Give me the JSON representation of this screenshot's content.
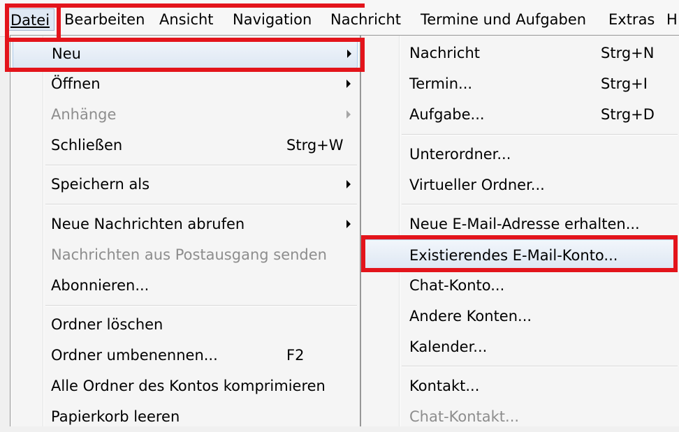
{
  "menubar": {
    "items": [
      {
        "label": "Datei"
      },
      {
        "label": "Bearbeiten"
      },
      {
        "label": "Ansicht"
      },
      {
        "label": "Navigation"
      },
      {
        "label": "Nachricht"
      },
      {
        "label": "Termine und Aufgaben"
      },
      {
        "label": "Extras"
      },
      {
        "label": "H"
      }
    ]
  },
  "file_menu": {
    "items": [
      {
        "label": "Neu",
        "submenu": true
      },
      {
        "label": "Öffnen",
        "submenu": true
      },
      {
        "label": "Anhänge",
        "submenu": true,
        "disabled": true
      },
      {
        "label": "Schließen",
        "shortcut": "Strg+W"
      },
      {
        "label": "Speichern als",
        "submenu": true
      },
      {
        "label": "Neue Nachrichten abrufen",
        "submenu": true
      },
      {
        "label": "Nachrichten aus Postausgang senden",
        "disabled": true
      },
      {
        "label": "Abonnieren..."
      },
      {
        "label": "Ordner löschen"
      },
      {
        "label": "Ordner umbenennen...",
        "shortcut": "F2"
      },
      {
        "label": "Alle Ordner des Kontos komprimieren"
      },
      {
        "label": "Papierkorb leeren"
      }
    ]
  },
  "new_submenu": {
    "items": [
      {
        "label": "Nachricht",
        "shortcut": "Strg+N"
      },
      {
        "label": "Termin...",
        "shortcut": "Strg+I"
      },
      {
        "label": "Aufgabe...",
        "shortcut": "Strg+D"
      },
      {
        "label": "Unterordner..."
      },
      {
        "label": "Virtueller Ordner..."
      },
      {
        "label": "Neue E-Mail-Adresse erhalten..."
      },
      {
        "label": "Existierendes E-Mail-Konto..."
      },
      {
        "label": "Chat-Konto..."
      },
      {
        "label": "Andere Konten..."
      },
      {
        "label": "Kalender..."
      },
      {
        "label": "Kontakt..."
      },
      {
        "label": "Chat-Kontakt...",
        "disabled": true
      }
    ]
  },
  "colors": {
    "highlight_box": "#e3141b",
    "hover_bg": "#dde7f3",
    "disabled_text": "#8d8d8d"
  }
}
